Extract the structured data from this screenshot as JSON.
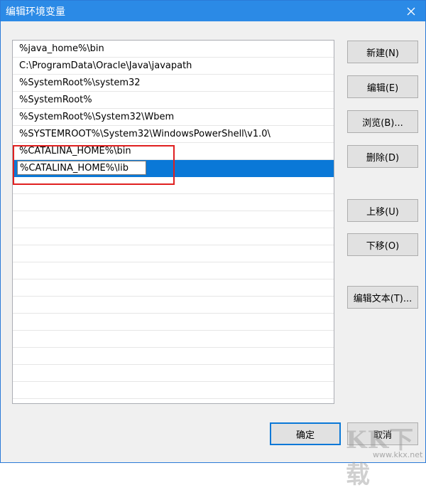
{
  "window": {
    "title": "编辑环境变量"
  },
  "list": {
    "items": [
      "%java_home%\\bin",
      "C:\\ProgramData\\Oracle\\Java\\javapath",
      "%SystemRoot%\\system32",
      "%SystemRoot%",
      "%SystemRoot%\\System32\\Wbem",
      "%SYSTEMROOT%\\System32\\WindowsPowerShell\\v1.0\\",
      "%CATALINA_HOME%\\bin"
    ],
    "editing_value": "%CATALINA_HOME%\\lib"
  },
  "buttons": {
    "new": "新建(N)",
    "edit": "编辑(E)",
    "browse": "浏览(B)...",
    "delete": "删除(D)",
    "move_up": "上移(U)",
    "move_down": "下移(O)",
    "edit_text": "编辑文本(T)...",
    "ok": "确定",
    "cancel": "取消"
  },
  "watermark": {
    "logo": "KK下载",
    "url": "www.kkx.net"
  },
  "colors": {
    "titlebar": "#2b8ae6",
    "selection": "#0a78d7",
    "highlight": "#e02020"
  }
}
